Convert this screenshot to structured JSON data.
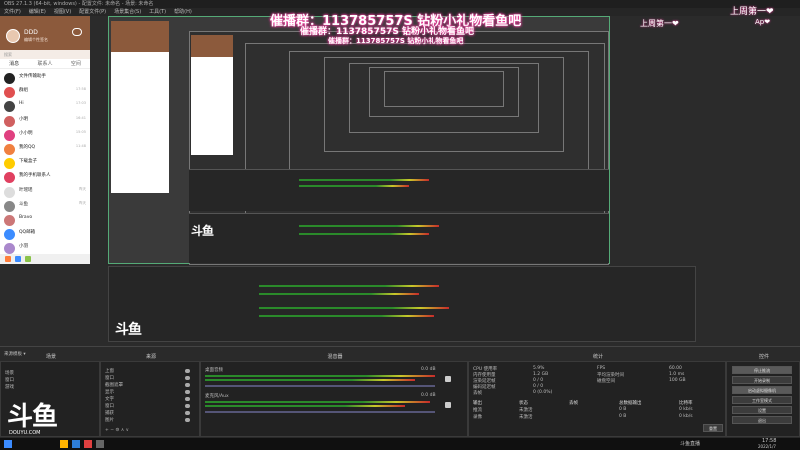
{
  "window": {
    "title": "OBS 27.1.3 (64-bit, windows) - 配置文件: 未命名 - 场景: 未命名"
  },
  "menu": [
    "文件(F)",
    "编辑(E)",
    "视图(V)",
    "配置文件(P)",
    "场景集合(S)",
    "工具(T)",
    "帮助(H)"
  ],
  "qq": {
    "name": "DDD",
    "sign": "编辑个性签名",
    "search": "搜索",
    "tabs": [
      "消息",
      "联系人",
      "空间"
    ],
    "items": [
      {
        "name": "文件传输助手",
        "msg": "",
        "time": ""
      },
      {
        "name": "群组",
        "msg": "",
        "time": "17:58"
      },
      {
        "name": "Hi",
        "msg": "",
        "time": "17:03"
      },
      {
        "name": "小明",
        "msg": "",
        "time": "16:41"
      },
      {
        "name": "小小明",
        "msg": "",
        "time": "15:05"
      },
      {
        "name": "我的QQ",
        "msg": "",
        "time": "11:48"
      },
      {
        "name": "下载盒子",
        "msg": "",
        "time": ""
      },
      {
        "name": "我的手机联系人",
        "msg": "",
        "time": ""
      },
      {
        "name": "叶瑶瑶",
        "msg": "",
        "time": "昨天"
      },
      {
        "name": "斗鱼",
        "msg": "",
        "time": "昨天"
      },
      {
        "name": "Bravo",
        "msg": "",
        "time": ""
      },
      {
        "name": "QQ邮箱",
        "msg": "",
        "time": ""
      },
      {
        "name": "小羽",
        "msg": "",
        "time": ""
      }
    ]
  },
  "banner": {
    "line1": "催播群：113785757S  钻粉小礼物看鱼吧",
    "line2": "催播群：113785757S  钻粉小礼物看鱼吧",
    "line3": "催播群：113785757S  钻粉小礼物看鱼吧"
  },
  "overlay": {
    "t1": "上周第一❤",
    "t2": "上周第一❤",
    "t3": "Ap❤"
  },
  "douyu": {
    "logo": "斗鱼",
    "domain": "DOUYU.COM"
  },
  "docks": {
    "scenes_title": "场景",
    "sources_title": "来源",
    "mixer_title": "混音器",
    "transitions_title": "统计",
    "controls_title": "控件",
    "scenes_label": "来源模板 ▾",
    "scene_items": [
      "场景",
      "窗口",
      "游戏"
    ],
    "source_items": [
      "上窗",
      "窗口",
      "截图遮罩",
      "显示",
      "文字",
      "窗口",
      "捕获",
      "图片"
    ],
    "mixer_labels": [
      "桌面音频",
      "麦克风/Aux"
    ],
    "mixer_db": [
      "0.0 dB",
      "0.0 dB"
    ],
    "stats": [
      [
        "CPU 使用率",
        "5.9%"
      ],
      [
        "内存使用量",
        "1.2 GB"
      ],
      [
        "渲染延迟帧",
        "0 / 0"
      ],
      [
        "编码延迟帧",
        "0 / 0"
      ],
      [
        "丢帧",
        "0 (0.0%)"
      ]
    ],
    "stats_right": [
      [
        "FPS",
        "60.00"
      ],
      [
        "平均渲染时间",
        "1.0 ms"
      ],
      [
        "磁盘空间",
        "100 GB"
      ]
    ],
    "output_head": [
      "输出",
      "状态",
      "丢帧",
      "总数据输出",
      "比特率"
    ],
    "output_rows": [
      [
        "推流",
        "未激活",
        "",
        "0 B",
        "0 kb/s"
      ],
      [
        "录像",
        "未激活",
        "",
        "0 B",
        "0 kb/s"
      ]
    ],
    "controls": [
      "停止推流",
      "开始录制",
      "启动虚拟摄像机",
      "工作室模式",
      "设置",
      "退出"
    ],
    "reset": "重置"
  },
  "taskbar": {
    "time": "17:58",
    "date": "2022/1/7",
    "app": "斗鱼直播"
  }
}
